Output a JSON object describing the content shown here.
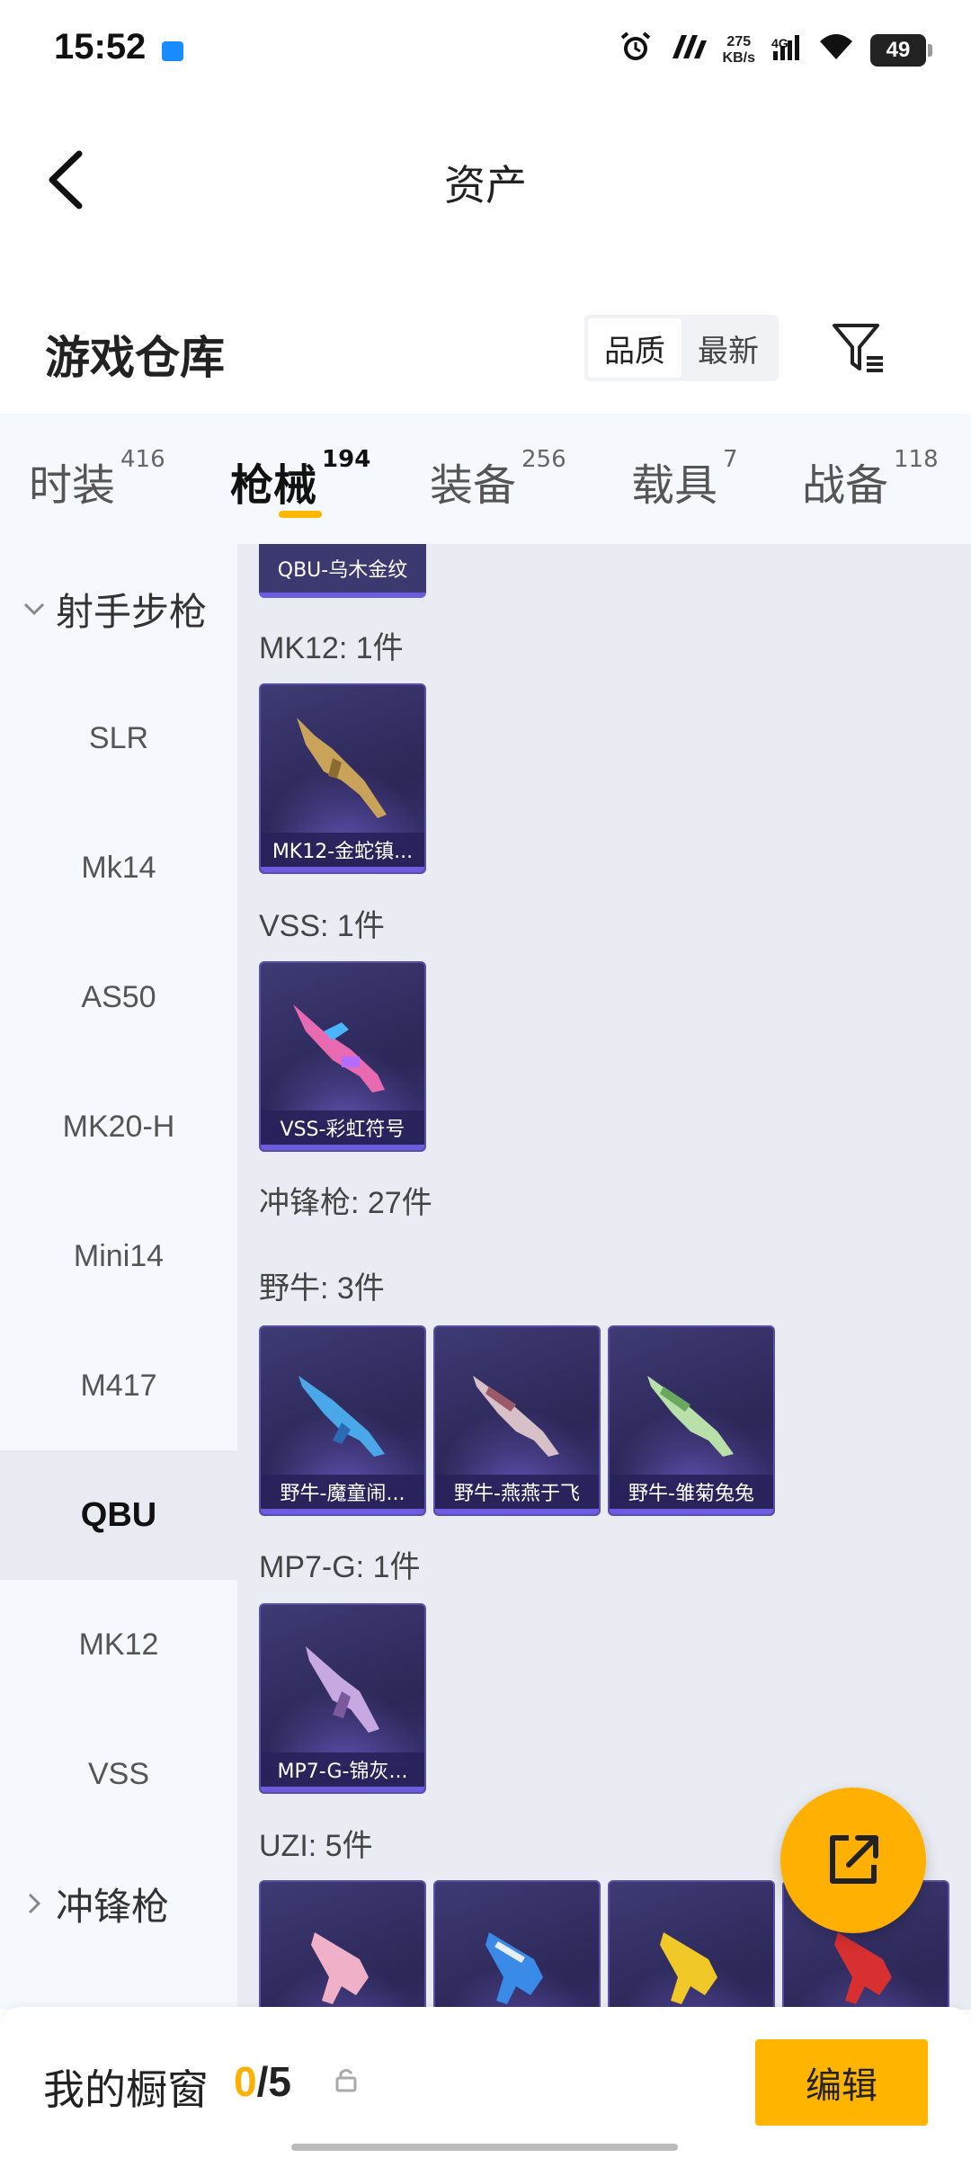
{
  "status_bar": {
    "time": "15:52",
    "net_speed_value": "275",
    "net_speed_unit": "KB/s",
    "signal_label": "4G",
    "battery": "49"
  },
  "nav": {
    "title": "资产"
  },
  "warehouse": {
    "title": "游戏仓库",
    "sort_options": [
      "品质",
      "最新"
    ],
    "sort_selected": "品质"
  },
  "tabs": [
    {
      "label": "时装",
      "count": "416"
    },
    {
      "label": "枪械",
      "count": "194",
      "active": true
    },
    {
      "label": "装备",
      "count": "256"
    },
    {
      "label": "载具",
      "count": "7"
    },
    {
      "label": "战备",
      "count": "118"
    }
  ],
  "sidebar": {
    "group_expanded": "射手步枪",
    "items": [
      "SLR",
      "Mk14",
      "AS50",
      "MK20-H",
      "Mini14",
      "M417",
      "QBU",
      "MK12",
      "VSS"
    ],
    "active_item": "QBU",
    "group_collapsed": "冲锋枪"
  },
  "content": {
    "partial_card_name": "QBU-乌木金纹",
    "sections": [
      {
        "label": "MK12: 1件",
        "cards": [
          "MK12-金蛇镇..."
        ]
      },
      {
        "label": "VSS: 1件",
        "cards": [
          "VSS-彩虹符号"
        ]
      },
      {
        "label": "冲锋枪: 27件"
      },
      {
        "label": "野牛: 3件",
        "cards": [
          "野牛-魔童闹...",
          "野牛-燕燕于飞",
          "野牛-雏菊兔兔"
        ]
      },
      {
        "label": "MP7-G: 1件",
        "cards": [
          "MP7-G-锦灰..."
        ]
      },
      {
        "label": "UZI: 5件"
      }
    ]
  },
  "bottom_bar": {
    "title": "我的橱窗",
    "count_current": "0",
    "count_total": "/5",
    "edit_label": "编辑"
  },
  "colors": {
    "accent": "#ffb000",
    "card_bg": "#2c2757",
    "card_border": "#6b5ce0"
  },
  "icons": [
    "app-notification-icon",
    "alarm-icon",
    "signal-icon",
    "wifi-icon",
    "back-arrow-icon",
    "filter-icon",
    "chevron-down-icon",
    "chevron-right-icon",
    "share-export-icon",
    "lock-icon"
  ]
}
